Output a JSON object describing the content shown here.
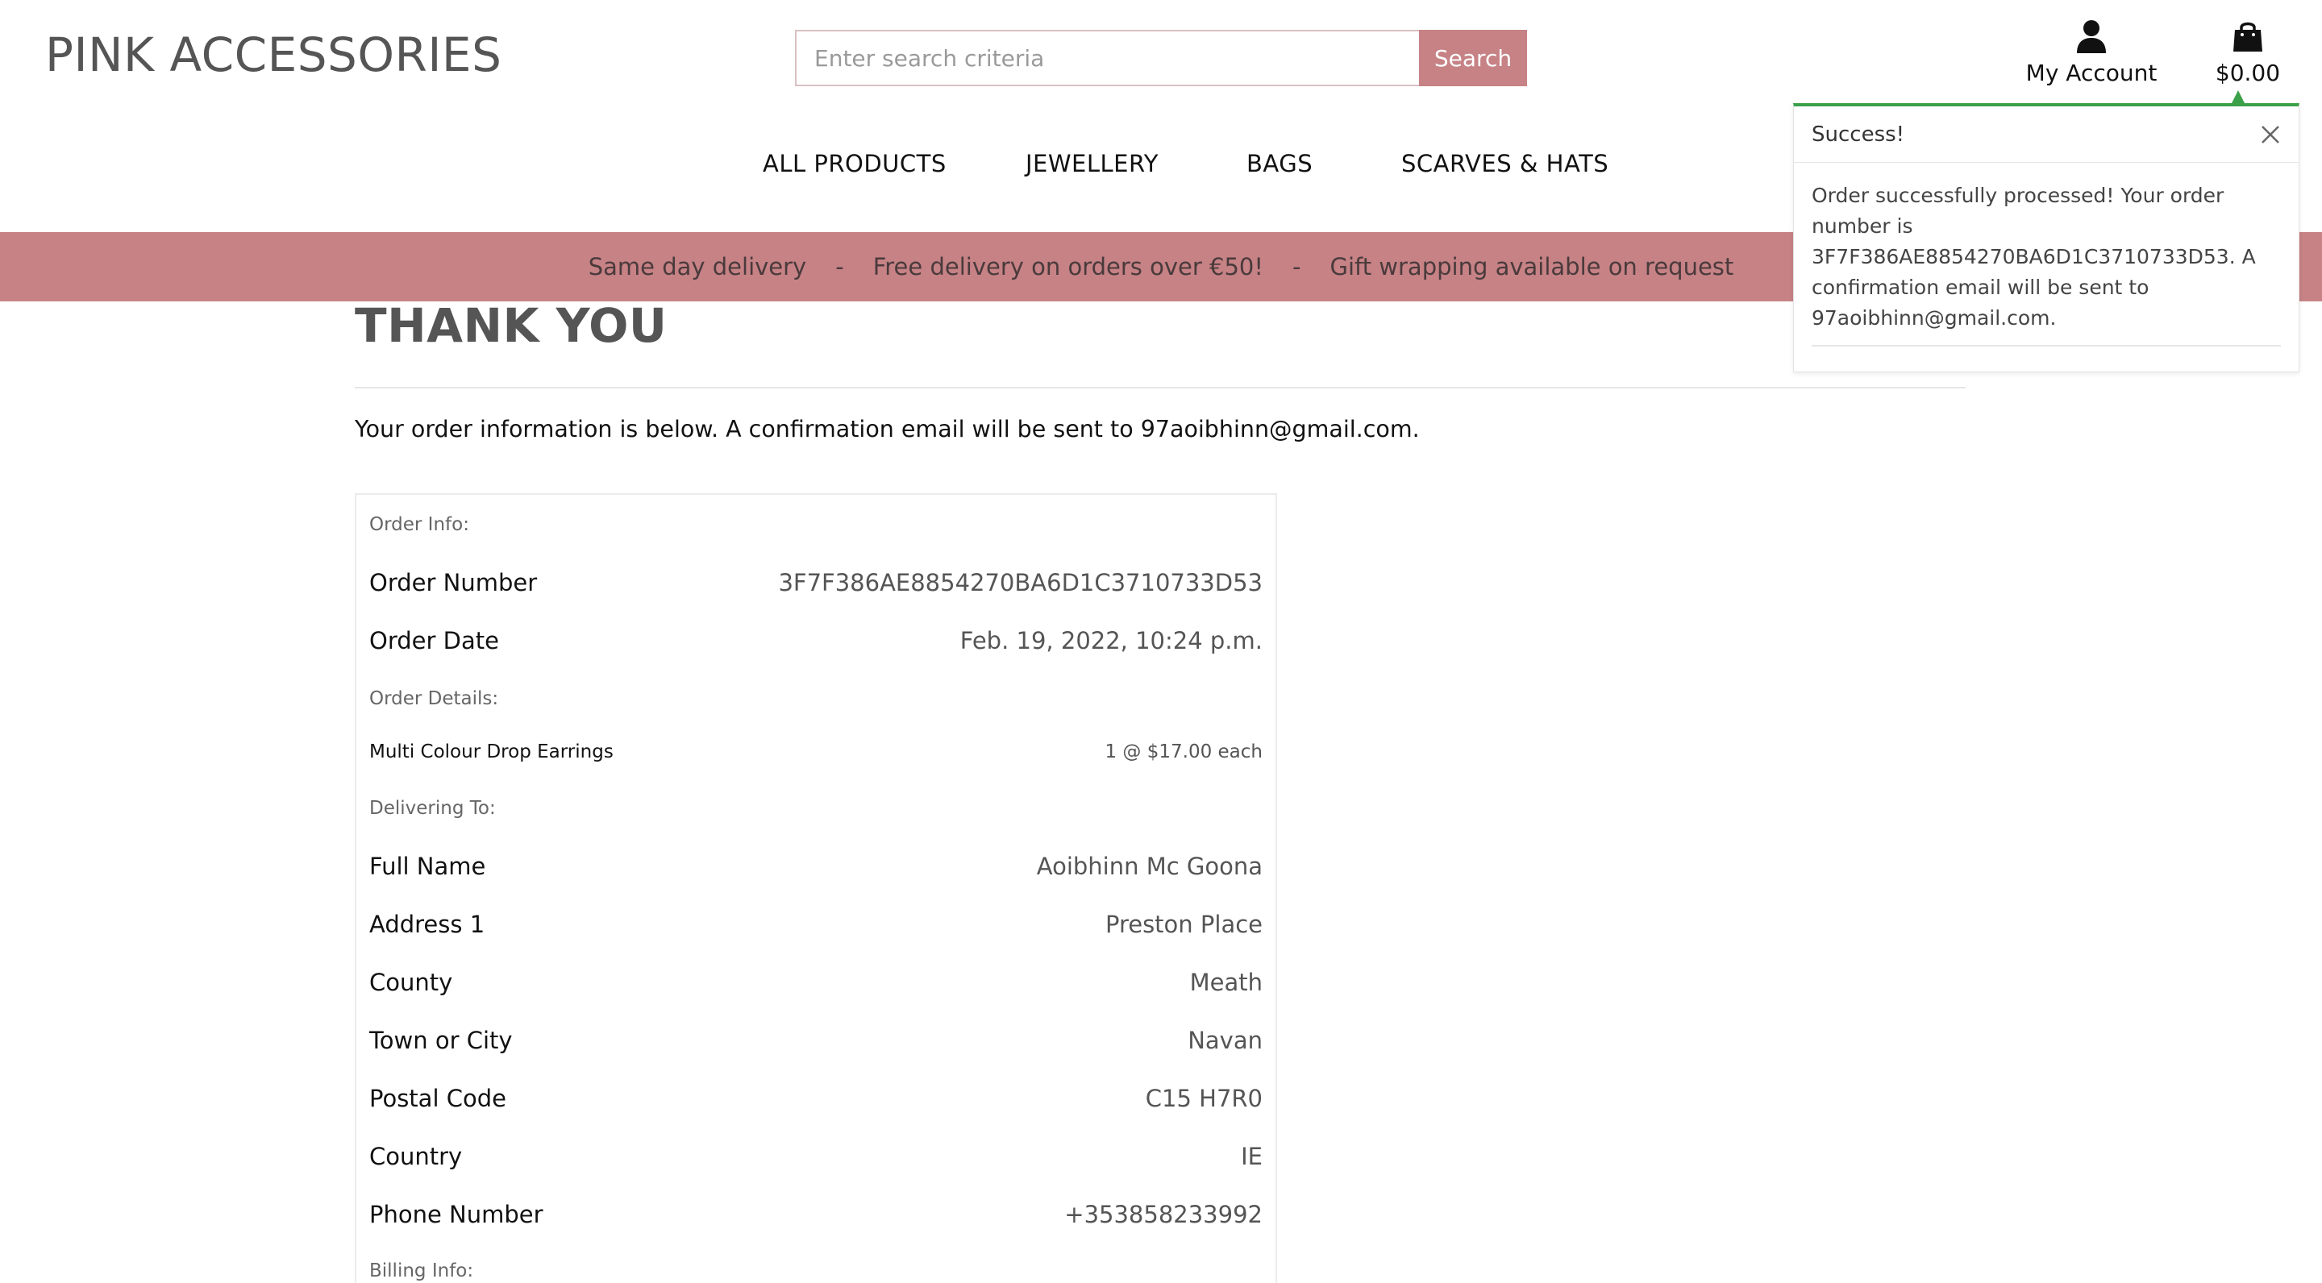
{
  "header": {
    "logo": "PINK ACCESSORIES",
    "search": {
      "placeholder": "Enter search criteria",
      "value": "",
      "button_label": "Search"
    },
    "account_label": "My Account",
    "bag_total": "$0.00"
  },
  "nav": {
    "items": [
      {
        "label": "ALL PRODUCTS"
      },
      {
        "label": "JEWELLERY"
      },
      {
        "label": "BAGS"
      },
      {
        "label": "SCARVES & HATS"
      }
    ]
  },
  "banner": {
    "items": [
      "Same day delivery",
      "Free delivery on orders over €50!",
      "Gift wrapping available on request"
    ],
    "separator": "-"
  },
  "main": {
    "title": "THANK YOU",
    "intro": "Your order information is below. A confirmation email will be sent to ",
    "email": "97aoibhinn@gmail.com",
    "intro_end": "."
  },
  "order": {
    "order_info_label": "Order Info:",
    "order_number_label": "Order Number",
    "order_number": "3F7F386AE8854270BA6D1C3710733D53",
    "order_date_label": "Order Date",
    "order_date": "Feb. 19, 2022, 10:24 p.m.",
    "order_details_label": "Order Details:",
    "item_name": "Multi Colour Drop Earrings",
    "item_qty": "1 @ $17.00 each",
    "delivering_label": "Delivering To:",
    "delivery": [
      {
        "label": "Full Name",
        "value": "Aoibhinn Mc Goona"
      },
      {
        "label": "Address 1",
        "value": "Preston Place"
      },
      {
        "label": "County",
        "value": "Meath"
      },
      {
        "label": "Town or City",
        "value": "Navan"
      },
      {
        "label": "Postal Code",
        "value": "C15 H7R0"
      },
      {
        "label": "Country",
        "value": "IE"
      },
      {
        "label": "Phone Number",
        "value": "+353858233992"
      }
    ],
    "billing_label": "Billing Info:"
  },
  "toast": {
    "title": "Success!",
    "message": "Order successfully processed! Your order number is 3F7F386AE8854270BA6D1C3710733D53. A confirmation email will be sent to 97aoibhinn@gmail.com.",
    "accent_color": "#3aa14a"
  },
  "colors": {
    "brand": "#c68285",
    "banner_text": "#4a3a3c"
  },
  "icons": {
    "account": "user-icon",
    "bag": "shopping-bag-icon",
    "close": "close-icon"
  }
}
